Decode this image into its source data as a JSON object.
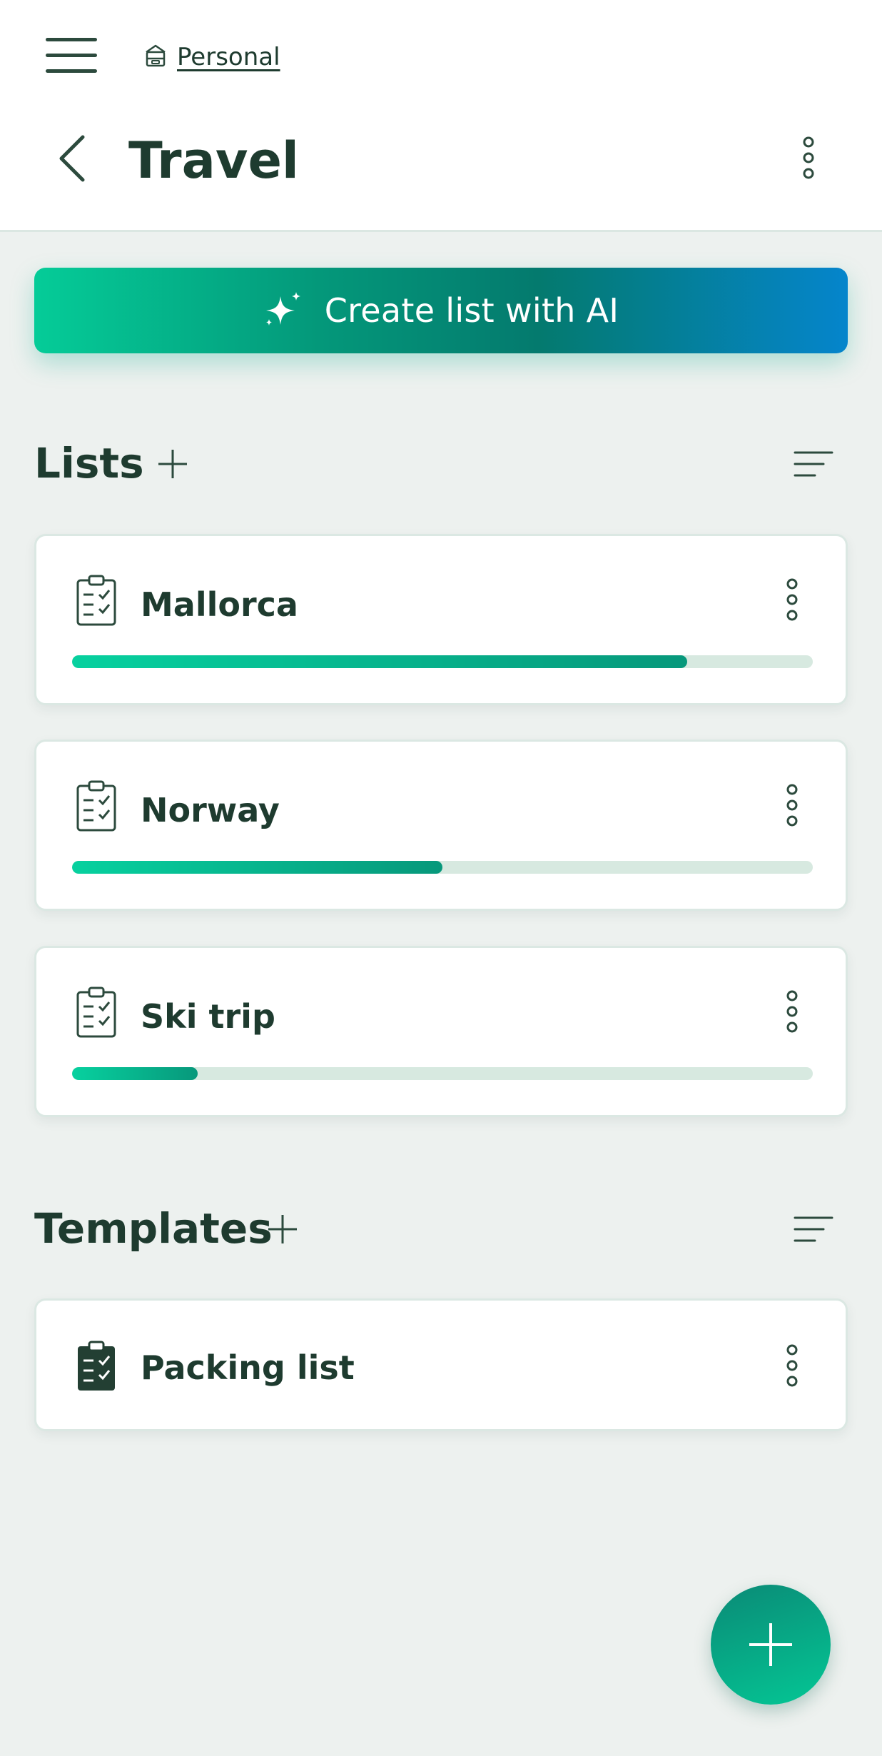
{
  "header": {
    "workspace_label": "Personal",
    "title": "Travel"
  },
  "ai_button": {
    "label": "Create list with AI"
  },
  "lists_section": {
    "title": "Lists",
    "items": [
      {
        "title": "Mallorca",
        "progress_percent": 83
      },
      {
        "title": "Norway",
        "progress_percent": 50
      },
      {
        "title": "Ski trip",
        "progress_percent": 17
      }
    ]
  },
  "templates_section": {
    "title": "Templates",
    "items": [
      {
        "title": "Packing list"
      }
    ]
  },
  "colors": {
    "accent_start": "#05cc98",
    "accent_mid": "#047a6e",
    "accent_end": "#0585cc",
    "text": "#1e3b2f",
    "background": "#edf1ef",
    "progress_track": "#d7e9e0"
  },
  "icons": {
    "menu": "hamburger-icon",
    "workspace": "archive-box-icon",
    "back": "chevron-left-icon",
    "more": "vertical-dots-icon",
    "ai": "sparkle-icon",
    "add": "plus-icon",
    "sort": "sort-lines-icon",
    "list": "clipboard-check-icon",
    "template": "clipboard-check-filled-icon",
    "fab": "plus-icon"
  }
}
